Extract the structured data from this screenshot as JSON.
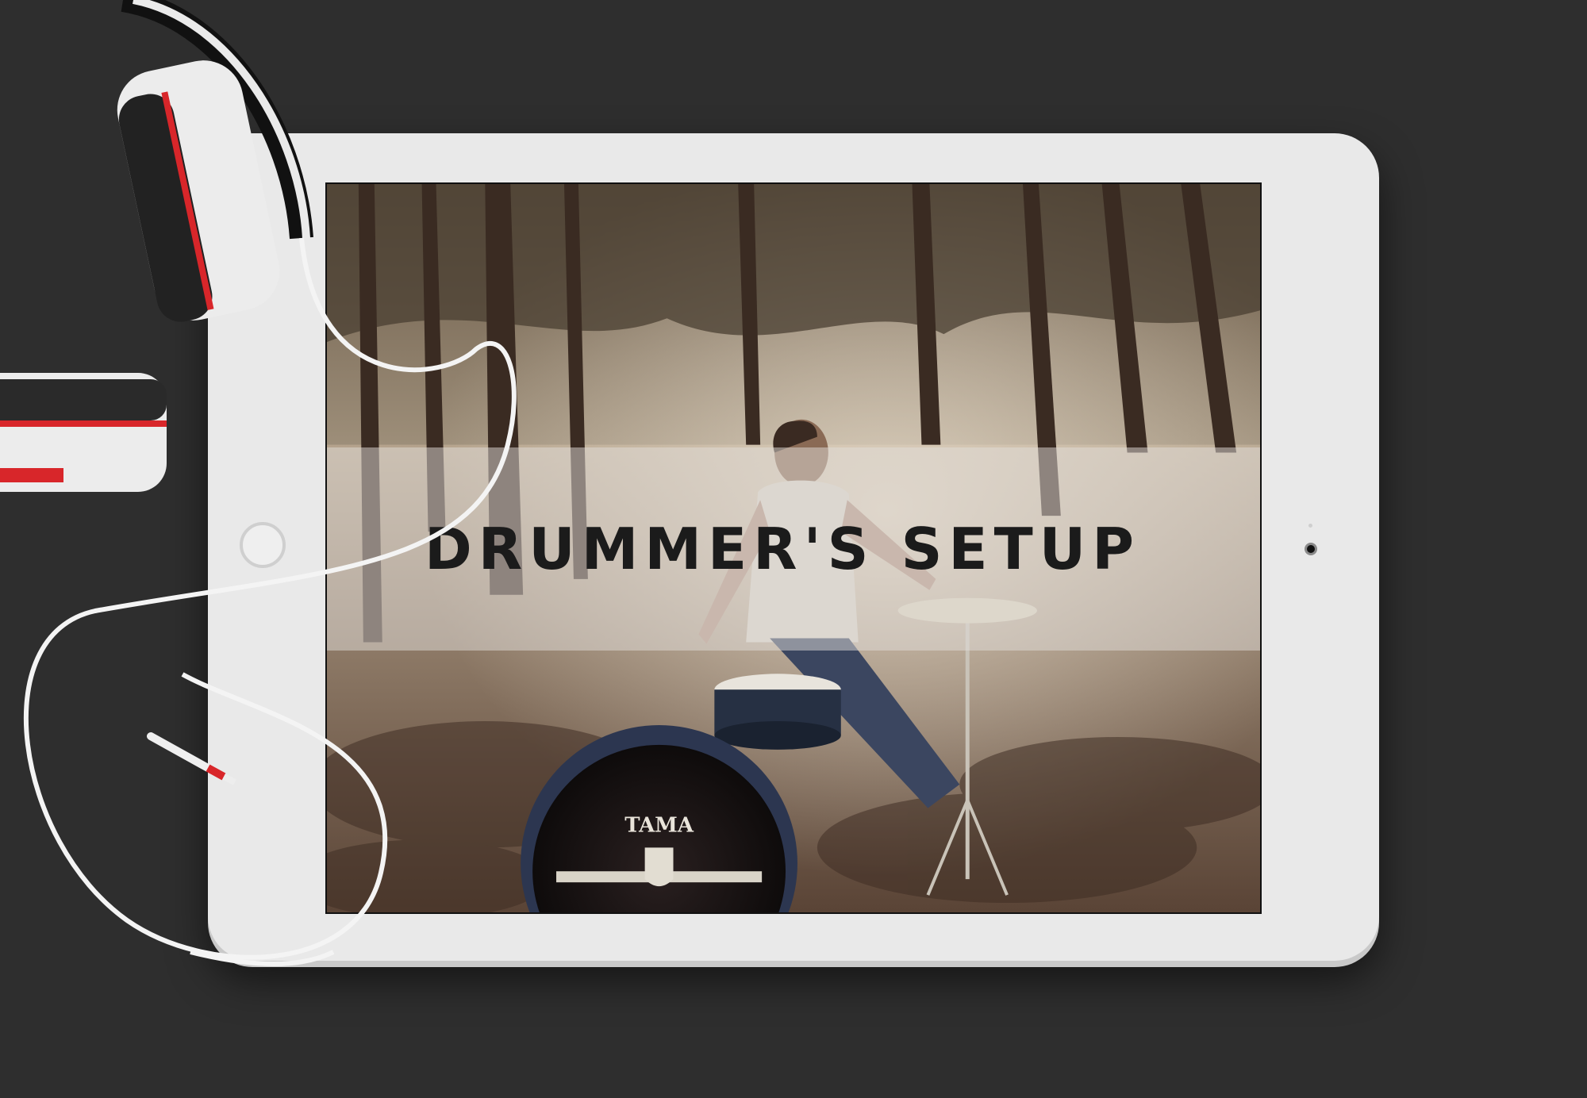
{
  "video": {
    "title": "DRUMMER'S SETUP",
    "kick_drum_brand": "TAMA"
  },
  "colors": {
    "background": "#2e2e2e",
    "device_body": "#e9e9e9",
    "headphone_accent": "#d8262a"
  }
}
